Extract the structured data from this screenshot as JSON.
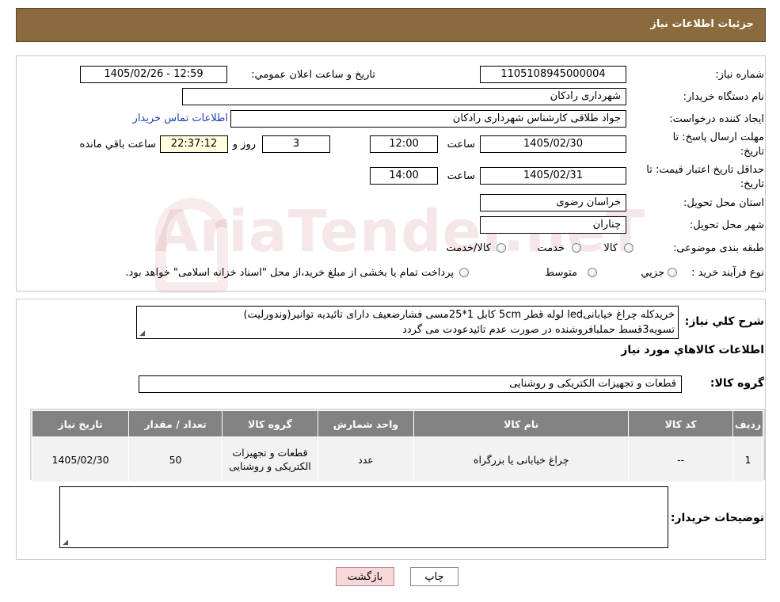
{
  "header": {
    "title": "جزئیات اطلاعات نیاز"
  },
  "form": {
    "need_number_label": "شماره نیاز:",
    "need_number": "1105108945000004",
    "announce_label": "تاريخ و ساعت اعلان عمومي:",
    "announce_value": "1405/02/26 - 12:59",
    "buyer_org_label": "نام دستگاه خريدار:",
    "buyer_org": "شهرداری رادکان",
    "creator_label": "ايجاد كننده درخواست:",
    "creator": "جواد طلاقی کارشناس شهرداری رادکان",
    "contact_link": "اطلاعات تماس خريدار",
    "send_deadline_label_1": "مهلت ارسال پاسخ: تا",
    "send_deadline_label_2": "تاريخ:",
    "send_deadline_date": "1405/02/30",
    "time_label": "ساعت",
    "send_deadline_time": "12:00",
    "days_value": "3",
    "days_label": "روز و",
    "remaining_time": "22:37:12",
    "remaining_label": "ساعت باقي مانده",
    "price_valid_label_1": "حداقل تاريخ اعتبار قيمت: تا",
    "price_valid_label_2": "تاريخ:",
    "price_valid_date": "1405/02/31",
    "price_valid_time": "14:00",
    "province_label": "استان محل تحويل:",
    "province": "خراسان رضوی",
    "city_label": "شهر محل تحويل:",
    "city": "چناران",
    "category_label": "طبقه بندی موضوعی:",
    "category_options": [
      "کالا",
      "خدمت",
      "کالا/خدمت"
    ],
    "purchase_type_label": "نوع فرآيند خريد :",
    "purchase_type_options": [
      "جزيي",
      "متوسط"
    ],
    "purchase_note": "پرداخت تمام يا بخشی از مبلغ خريد،از محل \"اسناد خزانه اسلامی\" خواهد بود."
  },
  "description": {
    "label": "شرح كلي نياز:",
    "line1": "خریدکله چراغ خیابانیled لوله قطر 5cm کابل 1*25مسی  فشارضعیف دارای تائیدیه توانیر(وندورلیت)",
    "line2": "تسویه3قسط  حملبافروشنده در صورت عدم تائیدعودت می گردد"
  },
  "goods": {
    "section_title": "اطلاعات كالاهاي مورد نياز",
    "group_label": "گروه کالا:",
    "group_value": "قطعات و تجهیزات الکتریکی و روشنایی",
    "columns": [
      "رديف",
      "كد كالا",
      "نام كالا",
      "واحد شمارش",
      "گروه كالا",
      "تعداد / مقدار",
      "تاريخ نياز"
    ],
    "rows": [
      {
        "row": "1",
        "code": "--",
        "name": "چراغ خیابانی یا بزرگراه",
        "unit": "عدد",
        "group": "قطعات و تجهیزات الکتریکی و روشنایی",
        "qty": "50",
        "date": "1405/02/30"
      }
    ]
  },
  "notes": {
    "label": "توضيحات خريدار:"
  },
  "buttons": {
    "print": "چاپ",
    "back": "بازگشت"
  },
  "watermark": "AriaTender.neT",
  "colors": {
    "header_bg": "#8B6A3E",
    "table_header": "#828282",
    "link": "#1a3fb5",
    "back_button_bg": "#F8D7DA"
  }
}
